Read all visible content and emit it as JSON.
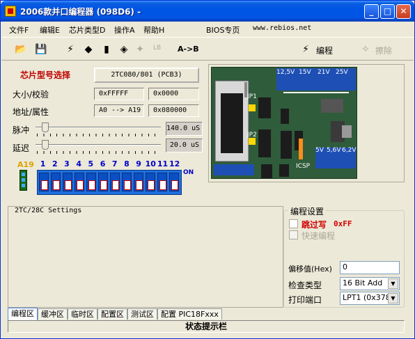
{
  "window": {
    "title": "2006款并口编程器 (098D6)  -"
  },
  "menu": [
    {
      "label": "文件F"
    },
    {
      "label": "编辑E"
    },
    {
      "label": "芯片类型D"
    },
    {
      "label": "操作A"
    },
    {
      "label": "帮助H"
    },
    {
      "label": "BIOS专页"
    },
    {
      "label": "www.rebios.net"
    }
  ],
  "toolbar": {
    "lb_label": "LB",
    "ab_label": "A->B",
    "program_label": "编程",
    "erase_label": "擦除"
  },
  "chip": {
    "select_label": "芯片型号选择",
    "select_value": "2TC080/801    (PCB3)",
    "size_label": "大小/校验",
    "size_value": "0xFFFFF",
    "checksum_value": "0x0000",
    "addr_label": "地址/属性",
    "addr_value": "A0 --> A19",
    "attr_value": "0x080000",
    "pulse_label": "脉冲",
    "pulse_value": "140.0 uS",
    "delay_label": "延迟",
    "delay_value": "20.0 uS"
  },
  "dip": {
    "a19": "A19",
    "numbers": [
      "1",
      "2",
      "3",
      "4",
      "5",
      "6",
      "7",
      "8",
      "9",
      "10",
      "11",
      "12"
    ],
    "on": "ON"
  },
  "board": {
    "voltages_top": [
      "12,5V",
      "15V",
      "21V",
      "25V"
    ],
    "voltages_bottom": [
      "5V",
      "5,6V",
      "6,2V"
    ],
    "jp1": "JP1",
    "jp2": "JP2",
    "icsp": "ICSP"
  },
  "settings": {
    "title": "2TC/28C Settings"
  },
  "prog": {
    "group_title": "编程设置",
    "skip_label": "跳过写",
    "skip_value": "0xFF",
    "fast_label": "快速编程",
    "offset_label": "偏移值(Hex)",
    "offset_value": "0",
    "check_label": "检查类型",
    "check_value": "16 Bit Add",
    "port_label": "打印端口",
    "port_value": "LPT1 (0x378)"
  },
  "tabs": [
    {
      "label": "编程区"
    },
    {
      "label": "缓冲区"
    },
    {
      "label": "临时区"
    },
    {
      "label": "配置区"
    },
    {
      "label": "测试区"
    },
    {
      "label": "配置 PIC18Fxxx"
    }
  ],
  "status": {
    "text": "状态提示栏"
  }
}
